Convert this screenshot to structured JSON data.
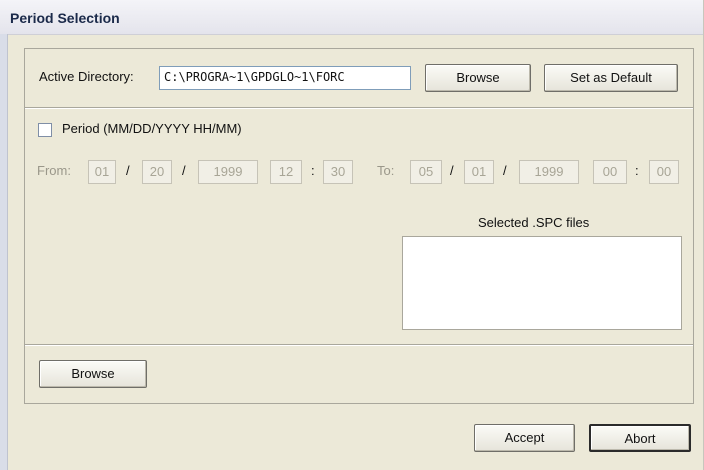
{
  "window": {
    "title": "Period Selection"
  },
  "directory": {
    "label": "Active Directory:",
    "value": "C:\\PROGRA~1\\GPDGLO~1\\FORC",
    "browse_label": "Browse",
    "default_label": "Set as Default"
  },
  "period": {
    "checkbox_label": "Period (MM/DD/YYYY HH/MM)",
    "checked": false,
    "from_label": "From:",
    "to_label": "To:",
    "from": {
      "month": "01",
      "day": "20",
      "year": "1999",
      "hour": "12",
      "minute": "30"
    },
    "to": {
      "month": "05",
      "day": "01",
      "year": "1999",
      "hour": "00",
      "minute": "00"
    },
    "date_sep": "/",
    "time_sep": ":"
  },
  "files": {
    "label": "Selected .SPC files",
    "items": []
  },
  "lower": {
    "browse_label": "Browse"
  },
  "footer": {
    "accept_label": "Accept",
    "abort_label": "Abort"
  }
}
